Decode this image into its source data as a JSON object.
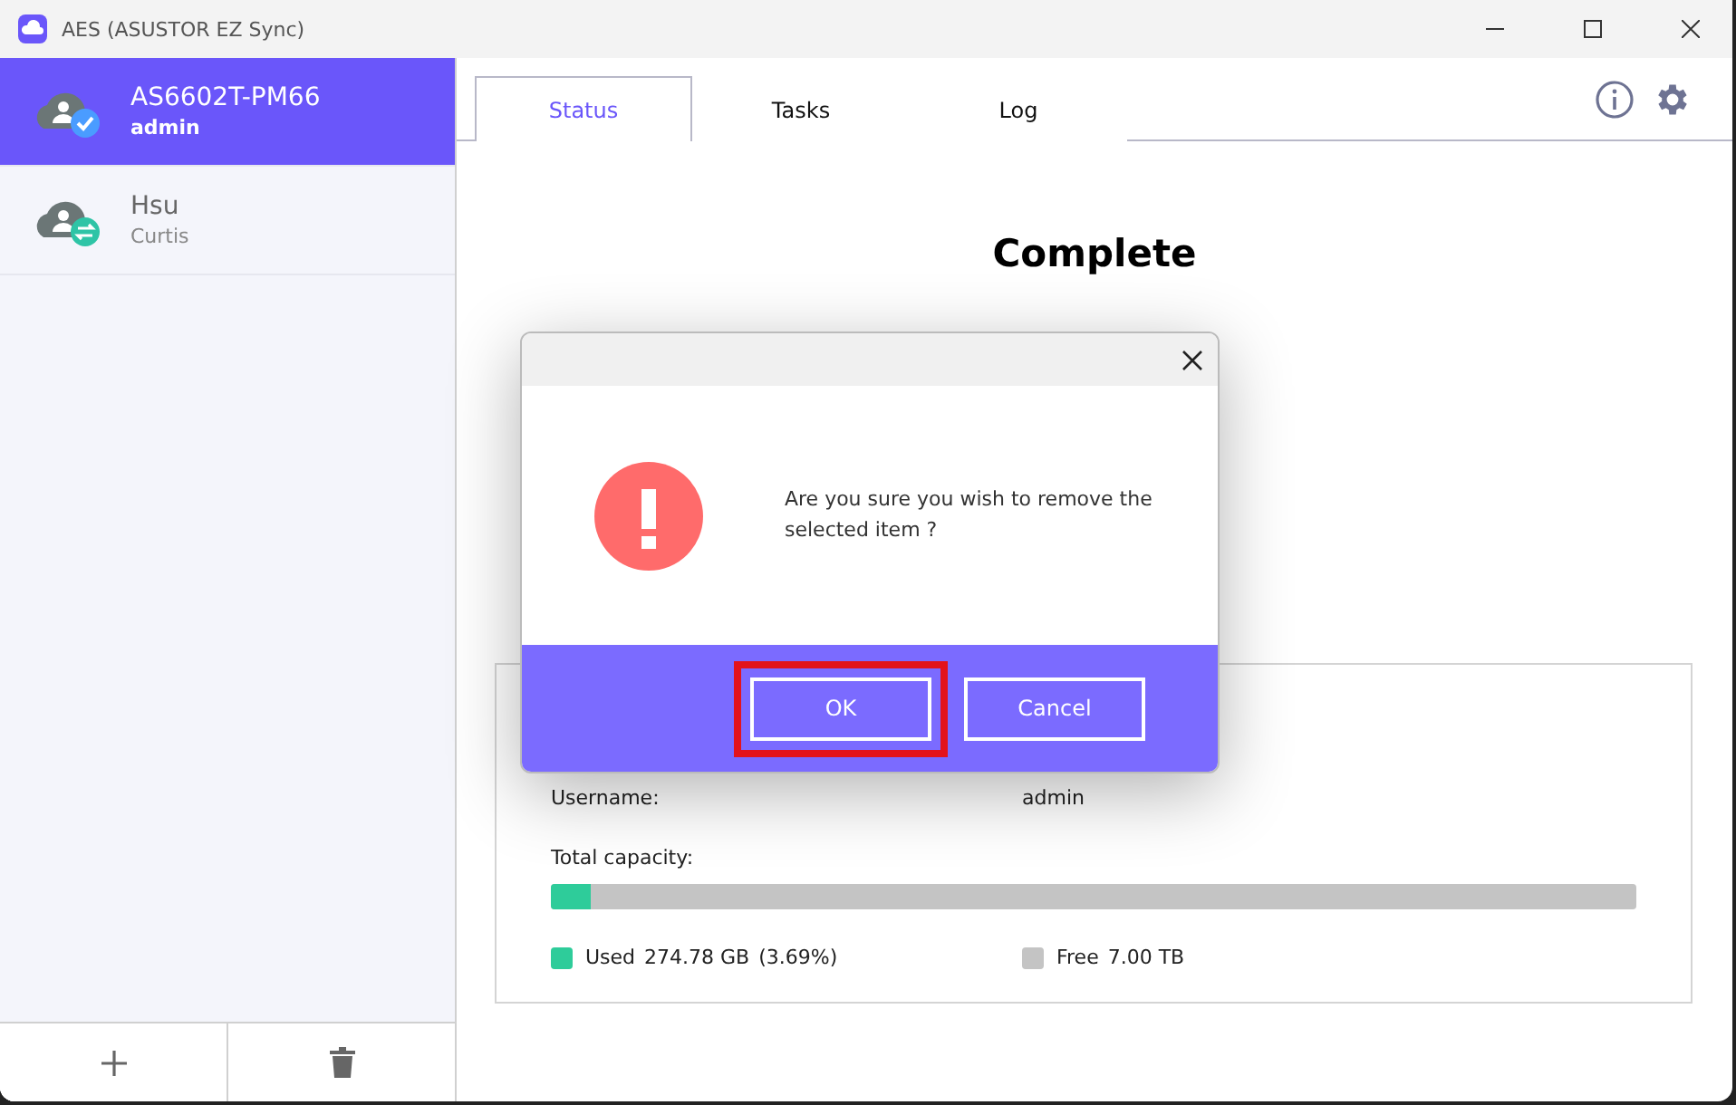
{
  "window": {
    "title": "AES (ASUSTOR EZ Sync)"
  },
  "sidebar": {
    "items": [
      {
        "name": "AS6602T-PM66",
        "user": "admin",
        "selected": true,
        "kind": "synced"
      },
      {
        "name": "Hsu",
        "user": "Curtis",
        "selected": false,
        "kind": "syncing"
      }
    ]
  },
  "tabs": [
    {
      "label": "Status",
      "selected": true
    },
    {
      "label": "Tasks",
      "selected": false
    },
    {
      "label": "Log",
      "selected": false
    }
  ],
  "status": {
    "title": "Complete"
  },
  "details": {
    "username_label": "Username:",
    "username": "admin",
    "capacity_label": "Total capacity:",
    "level": 0.0369,
    "legend": [
      {
        "label": "Used",
        "amount": "274.78 GB",
        "share": "(3.69%)",
        "color": "#2ecc9a"
      },
      {
        "label": "Free",
        "amount": "7.00 TB",
        "color": "#c4c4c4"
      }
    ]
  },
  "dialog": {
    "message": "Are you sure you wish to remove the selected item ?",
    "buttons": [
      {
        "label": "OK",
        "highlighted": true
      },
      {
        "label": "Cancel",
        "highlighted": false
      }
    ]
  }
}
